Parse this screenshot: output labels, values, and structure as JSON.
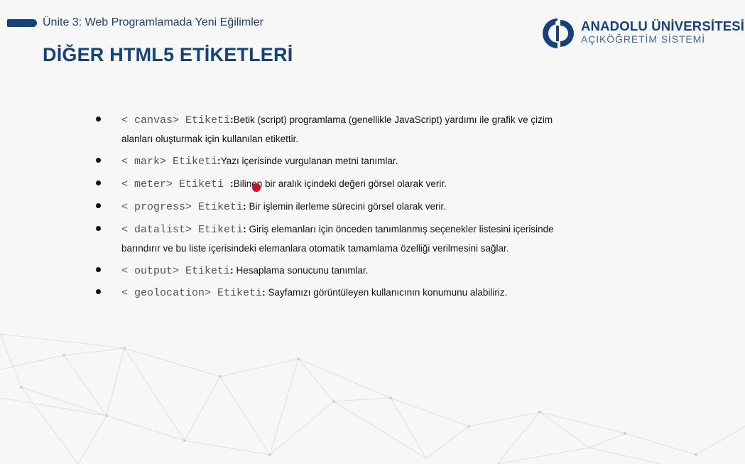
{
  "header": {
    "unit_label": "Ünite 3: Web Programlamada Yeni Eğilimler",
    "title": "DİĞER HTML5 ETİKETLERİ"
  },
  "logo": {
    "name": "ANADOLU ÜNİVERSİTESİ",
    "subtitle": "AÇIKÖĞRETİM SİSTEMİ"
  },
  "items": [
    {
      "tag": "< canvas> Etiketi",
      "separator": ":",
      "description": "Betik (script) programlama (genellikle JavaScript) yardımı ile grafik ve çizim",
      "continuation": "alanları oluşturmak için kullanılan etikettir."
    },
    {
      "tag": "< mark> Etiketi",
      "separator": ":",
      "description": "Yazı içerisinde vurgulanan metni tanımlar."
    },
    {
      "tag": "< meter> Etiketi ",
      "separator": ":",
      "description": "Bilinen bir aralık içindeki değeri görsel olarak verir."
    },
    {
      "tag": "< progress> Etiketi",
      "separator": ":",
      "description": " Bir işlemin ilerleme sürecini görsel olarak verir."
    },
    {
      "tag": "< datalist> Etiketi",
      "separator": ":",
      "description": " Giriş elemanları için önceden tanımlanmış seçenekler listesini içerisinde",
      "continuation": "barındırır ve bu liste içerisindeki elemanlara otomatik tamamlama özelliği verilmesini sağlar."
    },
    {
      "tag": "< output> Etiketi",
      "separator": ":",
      "description": " Hesaplama sonucunu tanımlar."
    },
    {
      "tag": "< geolocation> Etiketi",
      "separator": ":",
      "description": " Sayfamızı görüntüleyen kullanıcının konumunu alabiliriz."
    }
  ],
  "colors": {
    "brand_blue": "#16427a",
    "pointer_red": "#c8102e",
    "background": "#f7f7f7"
  }
}
